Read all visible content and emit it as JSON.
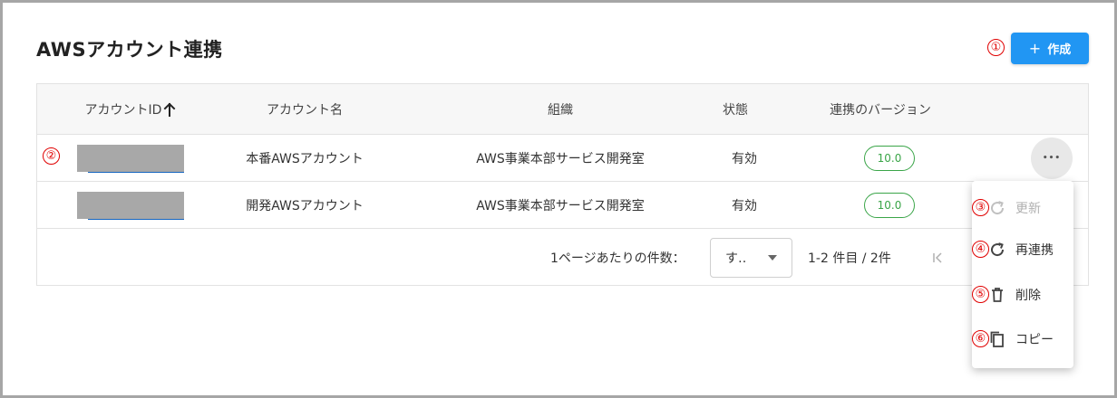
{
  "page": {
    "title": "AWSアカウント連携",
    "create_button": {
      "icon": "+",
      "label": "作成"
    }
  },
  "markers": [
    "①",
    "②",
    "③",
    "④",
    "⑤",
    "⑥"
  ],
  "table": {
    "columns": [
      {
        "label": "アカウントID",
        "sort": "ascending"
      },
      {
        "label": "アカウント名"
      },
      {
        "label": "組織"
      },
      {
        "label": "状態"
      },
      {
        "label": "連携のバージョン"
      }
    ],
    "sort_arrow": "🡑",
    "rows": [
      {
        "account_name": "本番AWSアカウント",
        "organization": "AWS事業本部サービス開発室",
        "status": "有効",
        "version": "10.0"
      },
      {
        "account_name": "開発AWSアカウント",
        "organization": "AWS事業本部サービス開発室",
        "status": "有効",
        "version": "10.0"
      }
    ],
    "more_button": "•••"
  },
  "pagination": {
    "per_page_label": "1ページあたりの件数：",
    "per_page_value": "す‥",
    "range_text": "1-2 件目 / 2件",
    "first_page_symbol": "|<"
  },
  "row_menu": {
    "items": [
      {
        "label": "更新",
        "icon": "refresh-icon",
        "disabled": true
      },
      {
        "label": "再連携",
        "icon": "refresh-icon",
        "disabled": false
      },
      {
        "label": "削除",
        "icon": "trash-icon",
        "disabled": false
      },
      {
        "label": "コピー",
        "icon": "copy-icon",
        "disabled": false
      }
    ]
  },
  "colors": {
    "primary": "#2196f3",
    "marker": "#e00000",
    "version_badge": "#3aa548",
    "redaction": "#a8a8a8"
  }
}
